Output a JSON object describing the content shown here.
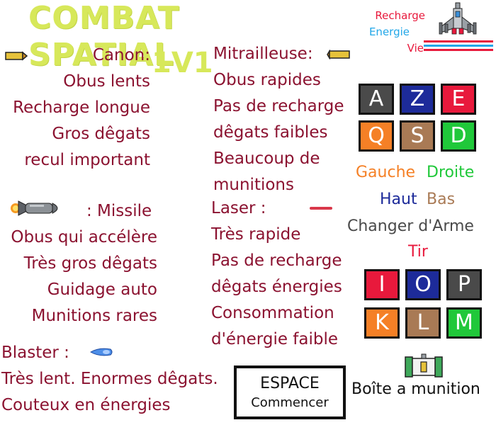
{
  "title": "COMBAT SPATIAL",
  "versus": "1V1",
  "legend": {
    "recharge_label": "Recharge",
    "energie_label": "Energie",
    "vie_label": "Vie",
    "recharge_color": "#e8193c",
    "energie_color": "#22a7e8",
    "vie_color": "#e8193c"
  },
  "weapons": {
    "canon": {
      "name": "Canon:",
      "lines": [
        "Obus lents",
        "Recharge longue",
        "Gros dêgats",
        "recul important"
      ]
    },
    "missile": {
      "name": ": Missile",
      "lines": [
        "Obus qui accélère",
        "Très gros dêgats",
        "Guidage auto",
        "Munitions rares"
      ]
    },
    "blaster": {
      "name": "Blaster :",
      "lines": [
        "Très lent. Enormes dêgats.",
        "Couteux en énergies"
      ]
    },
    "mitrailleuse": {
      "name": "Mitrailleuse:",
      "lines": [
        "Obus rapides",
        "Pas de recharge",
        "dêgats faibles",
        "Beaucoup de",
        "munitions"
      ]
    },
    "laser": {
      "name": "Laser :",
      "lines": [
        "Très rapide",
        "Pas de recharge",
        "dêgats énergies",
        "Consommation",
        "d'énergie faible"
      ]
    }
  },
  "player1_keys": [
    "A",
    "Z",
    "E",
    "Q",
    "S",
    "D"
  ],
  "player2_keys": [
    "I",
    "O",
    "P",
    "K",
    "L",
    "M"
  ],
  "key_colors": {
    "move_lr": "#f58026",
    "move_ud": "#a97a55",
    "switch": "#4a4a4a",
    "fire": "#e8193c",
    "right": "#20c83a",
    "up": "#1d2b9a"
  },
  "controls": {
    "gauche": "Gauche",
    "droite": "Droite",
    "haut": "Haut",
    "bas": "Bas",
    "changer": "Changer d'Arme",
    "tir": "Tir"
  },
  "ammo_box_label": "Boîte a munition",
  "start": {
    "key": "ESPACE",
    "action": "Commencer"
  }
}
